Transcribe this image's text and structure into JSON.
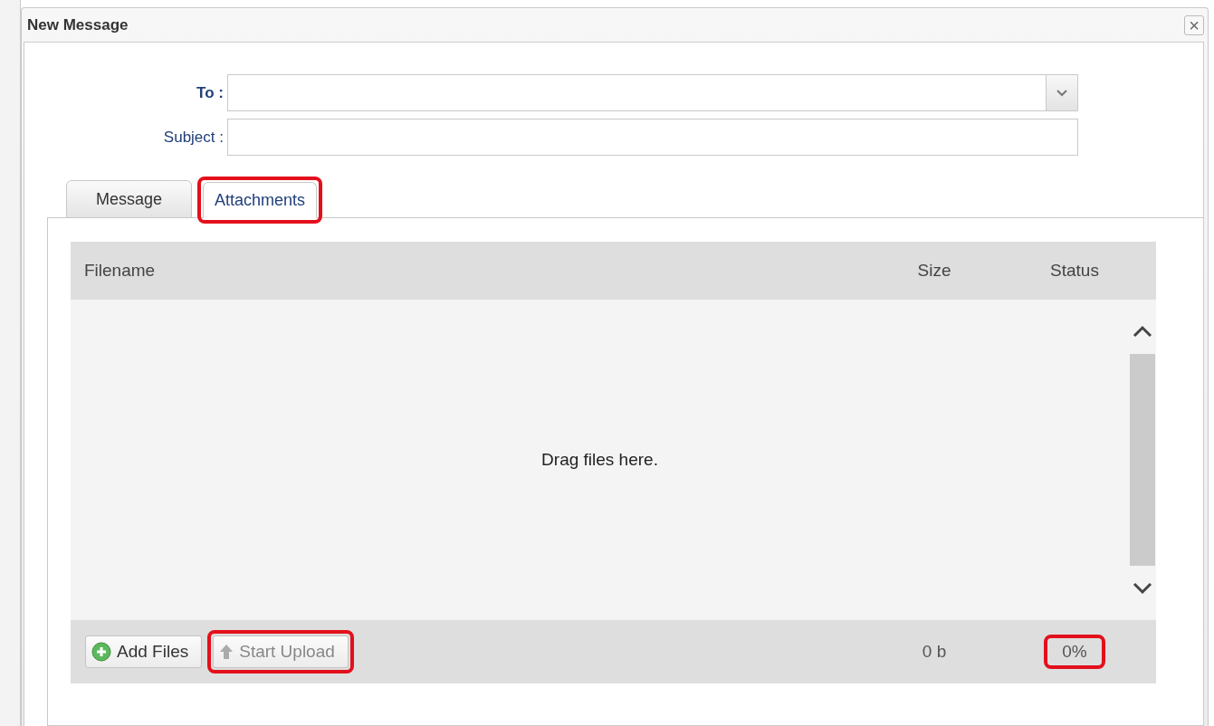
{
  "window": {
    "title": "New Message",
    "close": "×"
  },
  "form": {
    "fields": [
      {
        "kind": "combo",
        "label": "To :",
        "bold": true
      },
      {
        "kind": "text",
        "label": "Subject :",
        "bold": false
      }
    ]
  },
  "tabs": [
    {
      "label": "Message",
      "selected": false,
      "highlighted": false
    },
    {
      "label": "Attachments",
      "selected": true,
      "highlighted": true
    }
  ],
  "uploader": {
    "columns": [
      "Filename",
      "Size",
      "Status"
    ],
    "empty_text": "Drag files here.",
    "buttons": [
      {
        "label": "Add Files",
        "kind": "add",
        "disabled": false,
        "highlighted": false
      },
      {
        "label": "Start Upload",
        "kind": "upload",
        "disabled": true,
        "highlighted": true
      }
    ],
    "total_size": "0 b",
    "total_status": "0%",
    "status_highlighted": true
  }
}
